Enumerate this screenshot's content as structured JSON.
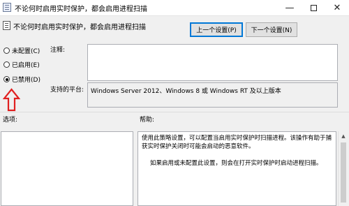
{
  "window": {
    "title": "不论何时启用实时保护，都会启用进程扫描",
    "minimize_glyph": "—",
    "close_glyph": "✕"
  },
  "header": {
    "title": "不论何时启用实时保护，都会启用进程扫描",
    "prev_button": "上一个设置(P)",
    "next_button": "下一个设置(N)"
  },
  "state": {
    "options": [
      {
        "label": "未配置(C)",
        "checked": false
      },
      {
        "label": "已启用(E)",
        "checked": false
      },
      {
        "label": "已禁用(D)",
        "checked": true
      }
    ]
  },
  "fields": {
    "comment_label": "注释:",
    "comment_value": "",
    "platform_label": "支持的平台:",
    "platform_value": "Windows Server 2012、Windows 8 或 Windows RT 及以上版本"
  },
  "panes": {
    "options_label": "选项:",
    "help_label": "帮助:",
    "help_p1": "使用此策略设置，可以配置当启用实时保护时扫描进程。该操作有助于捕获实时保护关闭时可能会启动的恶意软件。",
    "help_p2": "如果启用或未配置此设置，则会在打开实时保护时启动进程扫描。"
  },
  "annotation": {
    "arrow_color": "#e02020"
  }
}
